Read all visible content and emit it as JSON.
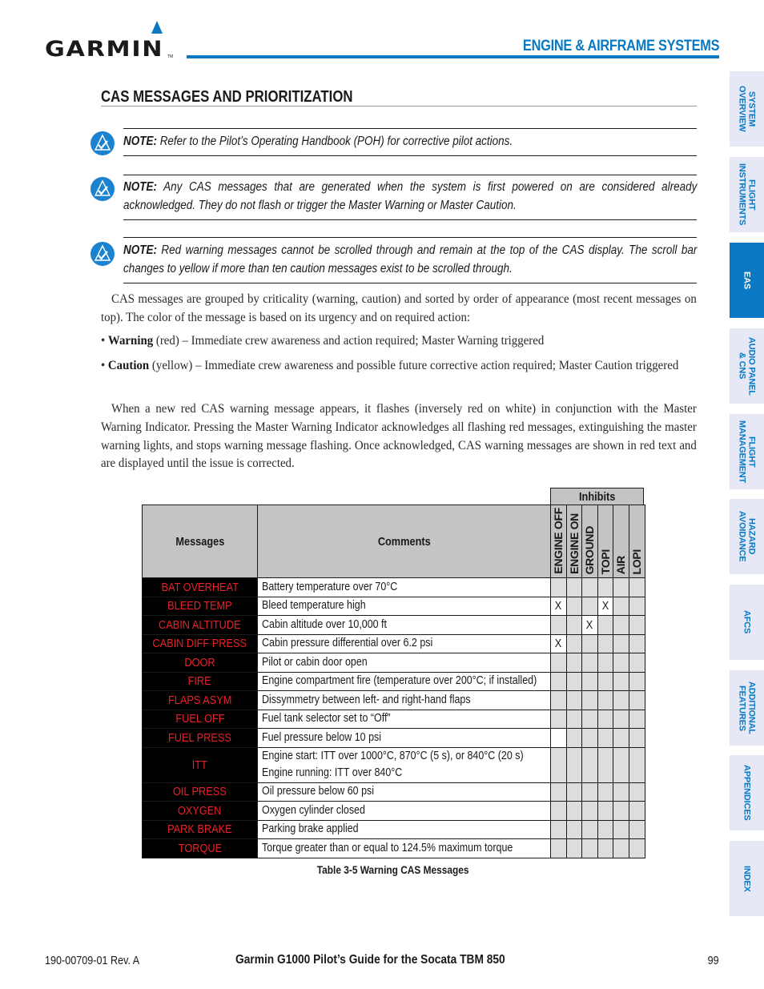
{
  "header": {
    "logo_text": "GARMIN",
    "logo_tm": "TM",
    "section_title": "ENGINE & AIRFRAME SYSTEMS",
    "brand_color": "#0a78c2"
  },
  "page_title": "CAS MESSAGES AND PRIORITIZATION",
  "notes": [
    {
      "label": "NOTE:",
      "text": " Refer to the Pilot’s Operating Handbook (POH) for corrective pilot actions."
    },
    {
      "label": "NOTE:",
      "text": " Any CAS messages that are generated when the system is first powered on are considered already acknowledged.  They do not flash or trigger the Master Warning or Master Caution."
    },
    {
      "label": "NOTE:",
      "text": " Red warning messages cannot be scrolled through and remain at the top of the CAS display.  The scroll bar changes to yellow if more than ten caution messages exist to be scrolled through."
    }
  ],
  "body": {
    "intro": "CAS messages are grouped by criticality (warning, caution) and sorted by order of appearance (most recent messages on top).  The color of the message is based on its urgency and on required action:",
    "bullets": [
      {
        "term": "Warning",
        "text": " (red) – Immediate crew awareness and action required; Master Warning triggered"
      },
      {
        "term": "Caution",
        "text": " (yellow) – Immediate crew awareness and possible future corrective action required; Master Caution triggered"
      }
    ],
    "paragraph2": "When a new red CAS warning message appears, it flashes (inversely red on white) in conjunction with the Master Warning Indicator.  Pressing the Master Warning Indicator acknowledges all flashing red messages, extinguishing the master warning lights, and stops warning message flashing.  Once acknowledged, CAS warning messages are shown in red text and are displayed until the issue is corrected."
  },
  "table": {
    "inhibits_label": "Inhibits",
    "columns": {
      "messages": "Messages",
      "comments": "Comments",
      "inhibits": [
        "ENGINE OFF",
        "ENGINE ON",
        "GROUND",
        "TOPI",
        "AIR",
        "LOPI"
      ]
    },
    "message_color": "#e8212a",
    "rows": [
      {
        "message": "BAT OVERHEAT",
        "comment": [
          "Battery temperature over 70°C"
        ],
        "inhibits": [
          "",
          "",
          "",
          "",
          "",
          ""
        ],
        "white": [
          false,
          false,
          false,
          false,
          false,
          false
        ]
      },
      {
        "message": "BLEED TEMP",
        "comment": [
          "Bleed temperature high"
        ],
        "inhibits": [
          "X",
          "",
          "",
          "X",
          "",
          ""
        ],
        "white": [
          true,
          false,
          false,
          true,
          false,
          false
        ]
      },
      {
        "message": "CABIN ALTITUDE",
        "comment": [
          "Cabin altitude over 10,000 ft"
        ],
        "inhibits": [
          "",
          "",
          "X",
          "",
          "",
          ""
        ],
        "white": [
          false,
          false,
          true,
          false,
          false,
          false
        ]
      },
      {
        "message": "CABIN DIFF PRESS",
        "comment": [
          "Cabin pressure differential over 6.2 psi"
        ],
        "inhibits": [
          "X",
          "",
          "",
          "",
          "",
          ""
        ],
        "white": [
          true,
          false,
          false,
          false,
          false,
          false
        ]
      },
      {
        "message": "DOOR",
        "comment": [
          "Pilot or cabin door open"
        ],
        "inhibits": [
          "",
          "",
          "",
          "",
          "",
          ""
        ],
        "white": [
          false,
          false,
          false,
          false,
          false,
          false
        ]
      },
      {
        "message": "FIRE",
        "comment": [
          "Engine compartment fire (temperature over 200°C; if installed)"
        ],
        "inhibits": [
          "",
          "",
          "",
          "",
          "",
          ""
        ],
        "white": [
          false,
          false,
          false,
          false,
          false,
          false
        ]
      },
      {
        "message": "FLAPS ASYM",
        "comment": [
          "Dissymmetry between left- and right-hand flaps"
        ],
        "inhibits": [
          "",
          "",
          "",
          "",
          "",
          ""
        ],
        "white": [
          false,
          false,
          false,
          false,
          false,
          false
        ]
      },
      {
        "message": "FUEL OFF",
        "comment": [
          "Fuel tank selector set to “Off”"
        ],
        "inhibits": [
          "",
          "",
          "",
          "",
          "",
          ""
        ],
        "white": [
          false,
          false,
          false,
          false,
          false,
          false
        ]
      },
      {
        "message": "FUEL PRESS",
        "comment": [
          "Fuel pressure below 10 psi"
        ],
        "inhibits": [
          "",
          "",
          "",
          "",
          "",
          ""
        ],
        "white": [
          true,
          false,
          false,
          false,
          false,
          false
        ]
      },
      {
        "message": "ITT",
        "comment": [
          "Engine start: ITT over 1000°C, 870°C (5 s), or 840°C (20 s)",
          "Engine running: ITT over 840°C"
        ],
        "inhibits": [
          "",
          "",
          "",
          "",
          "",
          ""
        ],
        "white": [
          false,
          false,
          false,
          false,
          false,
          false
        ]
      },
      {
        "message": "OIL PRESS",
        "comment": [
          "Oil pressure below 60 psi"
        ],
        "inhibits": [
          "",
          "",
          "",
          "",
          "",
          ""
        ],
        "white": [
          false,
          false,
          false,
          false,
          false,
          false
        ]
      },
      {
        "message": "OXYGEN",
        "comment": [
          "Oxygen cylinder closed"
        ],
        "inhibits": [
          "",
          "",
          "",
          "",
          "",
          ""
        ],
        "white": [
          false,
          false,
          false,
          false,
          false,
          false
        ]
      },
      {
        "message": "PARK BRAKE",
        "comment": [
          "Parking brake applied"
        ],
        "inhibits": [
          "",
          "",
          "",
          "",
          "",
          ""
        ],
        "white": [
          false,
          false,
          false,
          false,
          false,
          false
        ]
      },
      {
        "message": "TORQUE",
        "comment": [
          "Torque greater than or equal to 124.5% maximum torque"
        ],
        "inhibits": [
          "",
          "",
          "",
          "",
          "",
          ""
        ],
        "white": [
          false,
          false,
          false,
          false,
          false,
          false
        ]
      }
    ],
    "caption": "Table 3-5  Warning CAS Messages"
  },
  "side_tabs": [
    {
      "label": "SYSTEM\nOVERVIEW",
      "active": false
    },
    {
      "label": "FLIGHT\nINSTRUMENTS",
      "active": false
    },
    {
      "label": "EAS",
      "active": true
    },
    {
      "label": "AUDIO PANEL\n& CNS",
      "active": false
    },
    {
      "label": "FLIGHT\nMANAGEMENT",
      "active": false
    },
    {
      "label": "HAZARD\nAVOIDANCE",
      "active": false
    },
    {
      "label": "AFCS",
      "active": false
    },
    {
      "label": "ADDITIONAL\nFEATURES",
      "active": false
    },
    {
      "label": "APPENDICES",
      "active": false
    },
    {
      "label": "INDEX",
      "active": false
    }
  ],
  "footer": {
    "doc_number": "190-00709-01  Rev. A",
    "title": "Garmin G1000 Pilot’s Guide for the Socata TBM 850",
    "page_number": "99"
  }
}
